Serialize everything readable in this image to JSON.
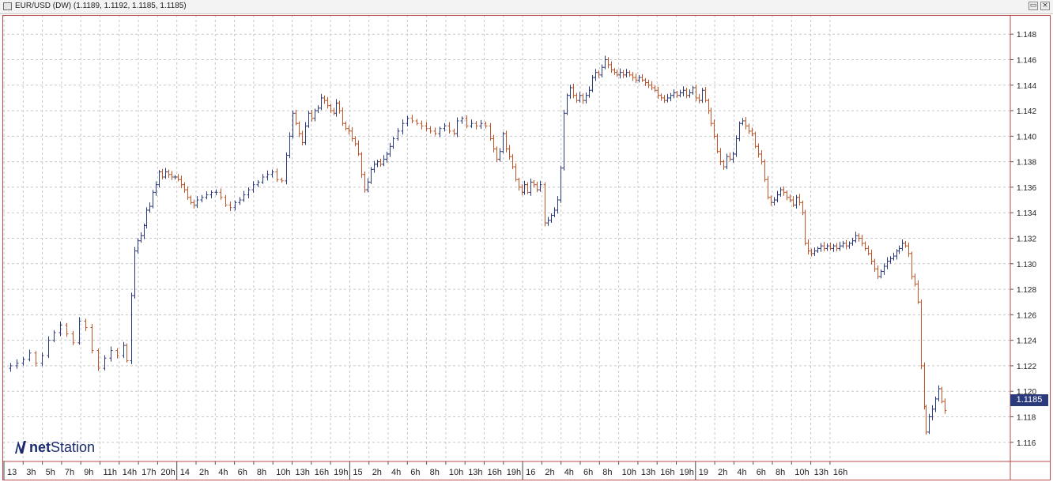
{
  "window": {
    "title": "EUR/USD (DW) (1.1189, 1.1192, 1.1185, 1.1185)",
    "buttons": [
      "▭",
      "×"
    ]
  },
  "logo": {
    "net": "net",
    "station": "Station"
  },
  "current_price": "1.1185",
  "colors": {
    "up": "#2b3a7a",
    "down": "#c0552a",
    "grid": "#c8c8c8",
    "frame": "#b84a4a",
    "badge": "#2b3a7a"
  },
  "chart_data": {
    "type": "ohlc",
    "symbol": "EUR/USD",
    "ylim": [
      1.1145,
      1.1495
    ],
    "y_ticks": [
      "1.148",
      "1.146",
      "1.144",
      "1.142",
      "1.140",
      "1.138",
      "1.136",
      "1.134",
      "1.132",
      "1.130",
      "1.128",
      "1.126",
      "1.124",
      "1.122",
      "1.120",
      "1.118",
      "1.116"
    ],
    "x_ticks": [
      "13",
      "3h",
      "5h",
      "7h",
      "9h",
      "11h",
      "14h",
      "17h",
      "20h",
      "14",
      "2h",
      "4h",
      "6h",
      "8h",
      "10h",
      "13h",
      "16h",
      "19h",
      "15",
      "2h",
      "4h",
      "6h",
      "8h",
      "10h",
      "13h",
      "16h",
      "19h",
      "16",
      "2h",
      "4h",
      "6h",
      "8h",
      "10h",
      "13h",
      "16h",
      "19h",
      "19",
      "2h",
      "4h",
      "6h",
      "8h",
      "10h",
      "13h",
      "16h"
    ],
    "day_separators_at": [
      "14",
      "15",
      "16",
      "19"
    ],
    "grid": true,
    "last": 1.1185,
    "path": [
      [
        0,
        1.1218
      ],
      [
        8,
        1.122
      ],
      [
        16,
        1.1222
      ],
      [
        24,
        1.1225
      ],
      [
        32,
        1.123
      ],
      [
        40,
        1.1222
      ],
      [
        48,
        1.1228
      ],
      [
        56,
        1.124
      ],
      [
        64,
        1.1246
      ],
      [
        72,
        1.1252
      ],
      [
        80,
        1.1245
      ],
      [
        88,
        1.1238
      ],
      [
        96,
        1.1255
      ],
      [
        104,
        1.125
      ],
      [
        112,
        1.1232
      ],
      [
        120,
        1.1218
      ],
      [
        128,
        1.1226
      ],
      [
        136,
        1.1232
      ],
      [
        144,
        1.1228
      ],
      [
        152,
        1.1236
      ],
      [
        156,
        1.1224
      ],
      [
        162,
        1.1275
      ],
      [
        166,
        1.131
      ],
      [
        170,
        1.1318
      ],
      [
        174,
        1.1322
      ],
      [
        178,
        1.133
      ],
      [
        182,
        1.1342
      ],
      [
        186,
        1.1345
      ],
      [
        190,
        1.1356
      ],
      [
        194,
        1.1362
      ],
      [
        198,
        1.1372
      ],
      [
        202,
        1.1368
      ],
      [
        206,
        1.1372
      ],
      [
        210,
        1.137
      ],
      [
        214,
        1.1368
      ],
      [
        218,
        1.1368
      ],
      [
        222,
        1.1366
      ],
      [
        226,
        1.1362
      ],
      [
        230,
        1.1358
      ],
      [
        234,
        1.1352
      ],
      [
        238,
        1.1348
      ],
      [
        242,
        1.1346
      ],
      [
        246,
        1.135
      ],
      [
        252,
        1.1352
      ],
      [
        258,
        1.1354
      ],
      [
        264,
        1.1356
      ],
      [
        270,
        1.1356
      ],
      [
        276,
        1.1352
      ],
      [
        282,
        1.1346
      ],
      [
        288,
        1.1344
      ],
      [
        294,
        1.1348
      ],
      [
        300,
        1.135
      ],
      [
        306,
        1.1354
      ],
      [
        312,
        1.1358
      ],
      [
        318,
        1.1362
      ],
      [
        324,
        1.1364
      ],
      [
        330,
        1.1368
      ],
      [
        336,
        1.137
      ],
      [
        342,
        1.1372
      ],
      [
        348,
        1.1366
      ],
      [
        354,
        1.1365
      ],
      [
        360,
        1.1385
      ],
      [
        364,
        1.14
      ],
      [
        368,
        1.1418
      ],
      [
        372,
        1.141
      ],
      [
        376,
        1.1402
      ],
      [
        380,
        1.1395
      ],
      [
        384,
        1.1408
      ],
      [
        388,
        1.1418
      ],
      [
        392,
        1.1414
      ],
      [
        396,
        1.142
      ],
      [
        400,
        1.1422
      ],
      [
        404,
        1.143
      ],
      [
        408,
        1.1428
      ],
      [
        412,
        1.1424
      ],
      [
        416,
        1.142
      ],
      [
        420,
        1.1418
      ],
      [
        424,
        1.1426
      ],
      [
        428,
        1.142
      ],
      [
        432,
        1.141
      ],
      [
        436,
        1.1406
      ],
      [
        440,
        1.1404
      ],
      [
        444,
        1.1398
      ],
      [
        448,
        1.1394
      ],
      [
        452,
        1.1386
      ],
      [
        456,
        1.137
      ],
      [
        460,
        1.1358
      ],
      [
        464,
        1.1364
      ],
      [
        468,
        1.1374
      ],
      [
        472,
        1.1378
      ],
      [
        476,
        1.138
      ],
      [
        480,
        1.1378
      ],
      [
        484,
        1.1382
      ],
      [
        488,
        1.1386
      ],
      [
        492,
        1.1392
      ],
      [
        496,
        1.1398
      ],
      [
        502,
        1.1404
      ],
      [
        508,
        1.141
      ],
      [
        514,
        1.1414
      ],
      [
        520,
        1.1412
      ],
      [
        526,
        1.141
      ],
      [
        532,
        1.1408
      ],
      [
        538,
        1.1406
      ],
      [
        544,
        1.1404
      ],
      [
        550,
        1.1402
      ],
      [
        556,
        1.1406
      ],
      [
        562,
        1.1408
      ],
      [
        568,
        1.1404
      ],
      [
        574,
        1.1402
      ],
      [
        578,
        1.1412
      ],
      [
        584,
        1.1414
      ],
      [
        590,
        1.1408
      ],
      [
        596,
        1.141
      ],
      [
        602,
        1.1408
      ],
      [
        608,
        1.141
      ],
      [
        614,
        1.1408
      ],
      [
        620,
        1.1398
      ],
      [
        624,
        1.139
      ],
      [
        628,
        1.1382
      ],
      [
        632,
        1.1388
      ],
      [
        636,
        1.1402
      ],
      [
        640,
        1.139
      ],
      [
        644,
        1.1384
      ],
      [
        648,
        1.1376
      ],
      [
        652,
        1.1366
      ],
      [
        656,
        1.136
      ],
      [
        660,
        1.1356
      ],
      [
        664,
        1.1362
      ],
      [
        668,
        1.1356
      ],
      [
        672,
        1.1364
      ],
      [
        676,
        1.1362
      ],
      [
        680,
        1.1358
      ],
      [
        684,
        1.1362
      ],
      [
        690,
        1.1332
      ],
      [
        694,
        1.1334
      ],
      [
        698,
        1.1338
      ],
      [
        702,
        1.1342
      ],
      [
        706,
        1.135
      ],
      [
        710,
        1.1375
      ],
      [
        714,
        1.1418
      ],
      [
        718,
        1.1432
      ],
      [
        722,
        1.1438
      ],
      [
        726,
        1.1432
      ],
      [
        730,
        1.1428
      ],
      [
        734,
        1.1432
      ],
      [
        738,
        1.1428
      ],
      [
        742,
        1.1432
      ],
      [
        746,
        1.1436
      ],
      [
        750,
        1.1446
      ],
      [
        754,
        1.145
      ],
      [
        758,
        1.1448
      ],
      [
        762,
        1.1454
      ],
      [
        766,
        1.146
      ],
      [
        770,
        1.1456
      ],
      [
        774,
        1.1452
      ],
      [
        778,
        1.145
      ],
      [
        782,
        1.1448
      ],
      [
        786,
        1.145
      ],
      [
        790,
        1.1448
      ],
      [
        794,
        1.145
      ],
      [
        798,
        1.1448
      ],
      [
        802,
        1.1446
      ],
      [
        806,
        1.1444
      ],
      [
        810,
        1.1446
      ],
      [
        814,
        1.1444
      ],
      [
        818,
        1.1442
      ],
      [
        822,
        1.144
      ],
      [
        826,
        1.1438
      ],
      [
        830,
        1.1436
      ],
      [
        834,
        1.1432
      ],
      [
        838,
        1.143
      ],
      [
        842,
        1.1428
      ],
      [
        846,
        1.143
      ],
      [
        850,
        1.1432
      ],
      [
        854,
        1.1434
      ],
      [
        858,
        1.1432
      ],
      [
        862,
        1.1434
      ],
      [
        866,
        1.1436
      ],
      [
        870,
        1.1432
      ],
      [
        874,
        1.1434
      ],
      [
        878,
        1.1438
      ],
      [
        882,
        1.143
      ],
      [
        886,
        1.1428
      ],
      [
        890,
        1.1436
      ],
      [
        894,
        1.1428
      ],
      [
        898,
        1.142
      ],
      [
        902,
        1.141
      ],
      [
        906,
        1.14
      ],
      [
        910,
        1.1388
      ],
      [
        914,
        1.138
      ],
      [
        918,
        1.1376
      ],
      [
        922,
        1.1384
      ],
      [
        926,
        1.1382
      ],
      [
        930,
        1.1386
      ],
      [
        934,
        1.1398
      ],
      [
        938,
        1.141
      ],
      [
        942,
        1.1412
      ],
      [
        946,
        1.1408
      ],
      [
        950,
        1.1404
      ],
      [
        954,
        1.1402
      ],
      [
        958,
        1.1392
      ],
      [
        962,
        1.1386
      ],
      [
        966,
        1.138
      ],
      [
        970,
        1.1366
      ],
      [
        974,
        1.1352
      ],
      [
        978,
        1.1348
      ],
      [
        982,
        1.135
      ],
      [
        986,
        1.1354
      ],
      [
        990,
        1.1358
      ],
      [
        994,
        1.1356
      ],
      [
        998,
        1.1352
      ],
      [
        1002,
        1.135
      ],
      [
        1006,
        1.1346
      ],
      [
        1010,
        1.1352
      ],
      [
        1014,
        1.1348
      ],
      [
        1018,
        1.134
      ],
      [
        1022,
        1.1316
      ],
      [
        1026,
        1.131
      ],
      [
        1030,
        1.1308
      ],
      [
        1034,
        1.131
      ],
      [
        1038,
        1.1312
      ],
      [
        1042,
        1.1314
      ],
      [
        1046,
        1.1312
      ],
      [
        1050,
        1.1314
      ],
      [
        1054,
        1.1312
      ],
      [
        1058,
        1.1314
      ],
      [
        1062,
        1.1312
      ],
      [
        1066,
        1.1314
      ],
      [
        1070,
        1.1316
      ],
      [
        1074,
        1.1314
      ],
      [
        1078,
        1.1316
      ],
      [
        1082,
        1.1318
      ],
      [
        1086,
        1.1322
      ],
      [
        1090,
        1.132
      ],
      [
        1094,
        1.1316
      ],
      [
        1098,
        1.1312
      ],
      [
        1102,
        1.1308
      ],
      [
        1106,
        1.1302
      ],
      [
        1110,
        1.1296
      ],
      [
        1114,
        1.129
      ],
      [
        1118,
        1.1294
      ],
      [
        1122,
        1.1298
      ],
      [
        1126,
        1.1302
      ],
      [
        1130,
        1.1304
      ],
      [
        1134,
        1.1306
      ],
      [
        1138,
        1.131
      ],
      [
        1142,
        1.1312
      ],
      [
        1146,
        1.1316
      ],
      [
        1150,
        1.1314
      ],
      [
        1154,
        1.1308
      ],
      [
        1158,
        1.129
      ],
      [
        1162,
        1.1284
      ],
      [
        1166,
        1.127
      ],
      [
        1170,
        1.122
      ],
      [
        1174,
        1.1188
      ],
      [
        1176,
        1.1168
      ],
      [
        1180,
        1.118
      ],
      [
        1184,
        1.1186
      ],
      [
        1188,
        1.1194
      ],
      [
        1192,
        1.1202
      ],
      [
        1196,
        1.1192
      ],
      [
        1200,
        1.1185
      ]
    ]
  }
}
